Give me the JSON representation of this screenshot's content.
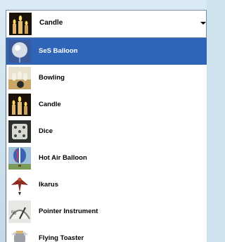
{
  "combo": {
    "selected_label": "Candle",
    "selected_icon": "candle-icon"
  },
  "list": {
    "items": [
      {
        "label": "SeS Balloon",
        "icon": "balloon-icon",
        "selected": true
      },
      {
        "label": "Bowling",
        "icon": "bowling-icon",
        "selected": false
      },
      {
        "label": "Candle",
        "icon": "candle-icon",
        "selected": false
      },
      {
        "label": "Dice",
        "icon": "dice-icon",
        "selected": false
      },
      {
        "label": "Hot Air Balloon",
        "icon": "hot-air-balloon-icon",
        "selected": false
      },
      {
        "label": "Ikarus",
        "icon": "ikarus-icon",
        "selected": false
      },
      {
        "label": "Pointer Instrument",
        "icon": "pointer-instrument-icon",
        "selected": false
      },
      {
        "label": "Flying Toaster",
        "icon": "flying-toaster-icon",
        "selected": false
      }
    ]
  },
  "colors": {
    "selection": "#2f65b8",
    "background": "#ffffff"
  }
}
